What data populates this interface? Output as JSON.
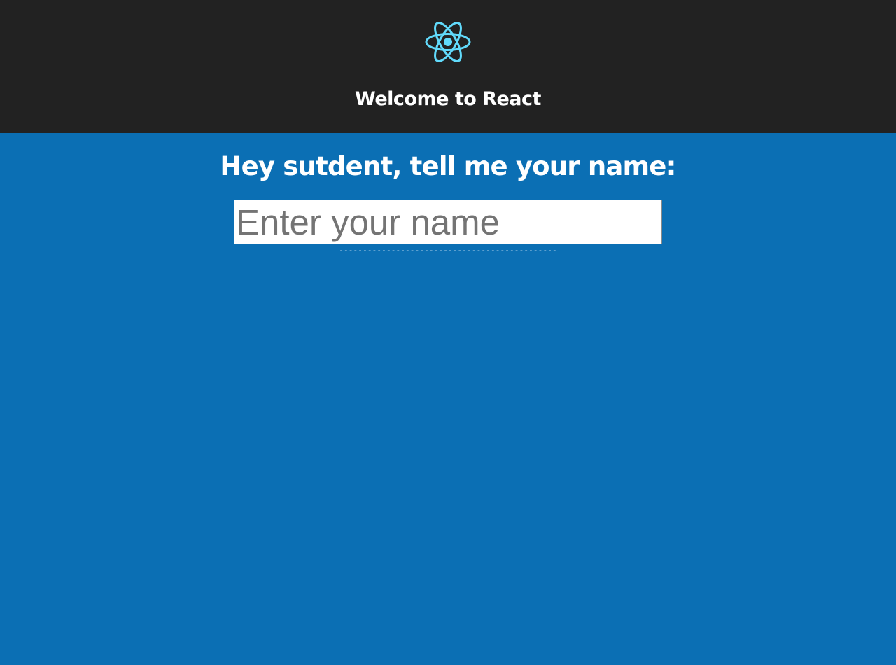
{
  "header": {
    "logo_icon": "react-atom-icon",
    "logo_color": "#61dafb",
    "background_color": "#222222",
    "title": "Welcome to React"
  },
  "main": {
    "background_color": "#0b6fb4",
    "heading": "Hey sutdent, tell me your name:",
    "name_input": {
      "value": "",
      "placeholder": "Enter your name"
    },
    "separator": "----------------------------------------------"
  }
}
